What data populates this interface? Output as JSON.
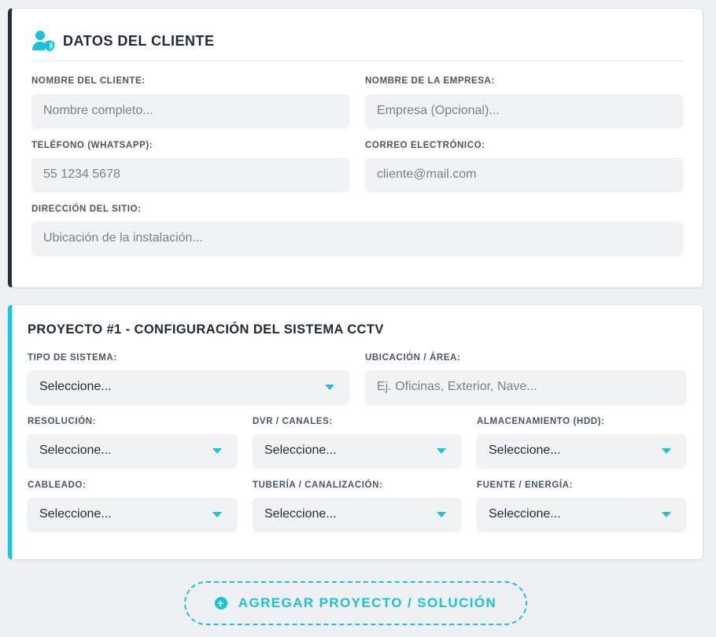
{
  "client": {
    "title": "DATOS DEL CLIENTE",
    "icon": "user-shield-icon",
    "fields": {
      "name": {
        "label": "NOMBRE DEL CLIENTE:",
        "placeholder": "Nombre completo..."
      },
      "company": {
        "label": "NOMBRE DE LA EMPRESA:",
        "placeholder": "Empresa (Opcional)..."
      },
      "phone": {
        "label": "TELÉFONO (WHATSAPP):",
        "placeholder": "55 1234 5678"
      },
      "email": {
        "label": "CORREO ELECTRÓNICO:",
        "placeholder": "cliente@mail.com"
      },
      "address": {
        "label": "DIRECCIÓN DEL SITIO:",
        "placeholder": "Ubicación de la instalación..."
      }
    }
  },
  "project": {
    "title": "PROYECTO #1 - CONFIGURACIÓN DEL SISTEMA CCTV",
    "fields": {
      "system_type": {
        "label": "TIPO DE SISTEMA:",
        "value": "Seleccione..."
      },
      "location": {
        "label": "UBICACIÓN / ÁREA:",
        "placeholder": "Ej. Oficinas, Exterior, Nave..."
      },
      "resolution": {
        "label": "RESOLUCIÓN:",
        "value": "Seleccione..."
      },
      "dvr": {
        "label": "DVR / CANALES:",
        "value": "Seleccione..."
      },
      "storage": {
        "label": "ALMACENAMIENTO (HDD):",
        "value": "Seleccione..."
      },
      "cabling": {
        "label": "CABLEADO:",
        "value": "Seleccione..."
      },
      "conduit": {
        "label": "TUBERÍA / CANALIZACIÓN:",
        "value": "Seleccione..."
      },
      "power": {
        "label": "FUENTE / ENERGÍA:",
        "value": "Seleccione..."
      }
    }
  },
  "actions": {
    "add_project_label": "AGREGAR PROYECTO / SOLUCIÓN",
    "add_icon": "plus-circle-icon"
  },
  "colors": {
    "accent": "#19c2d8",
    "client_border": "#2a2d3a",
    "text_dark": "#1f2a37",
    "background": "#eef0f3"
  }
}
